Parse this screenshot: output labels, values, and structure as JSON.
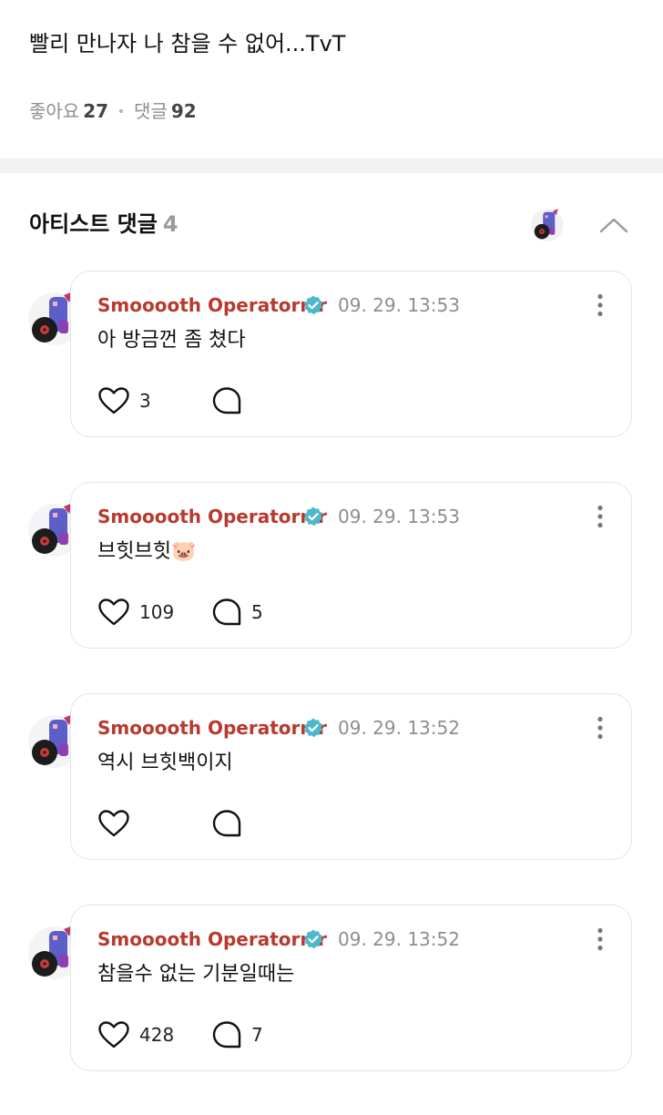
{
  "post": {
    "text": "빨리 만나자 나 참을 수 없어...TvT",
    "likes_label": "좋아요",
    "likes_count": "27",
    "comments_label": "댓글",
    "comments_count": "92"
  },
  "artist_comments": {
    "title": "아티스트 댓글",
    "count": "4",
    "collapse_icon": "chevron-up-icon"
  },
  "comments": [
    {
      "author": "Smooooth Operatorrrr",
      "verified": true,
      "time": "09. 29. 13:53",
      "text": "아 방금껀 좀 쳤다",
      "likes": "3",
      "replies": ""
    },
    {
      "author": "Smooooth Operatorrrr",
      "verified": true,
      "time": "09. 29. 13:53",
      "text": "브힛브힛🐷",
      "likes": "109",
      "replies": "5"
    },
    {
      "author": "Smooooth Operatorrrr",
      "verified": true,
      "time": "09. 29. 13:52",
      "text": "역시 브힛백이지",
      "likes": "",
      "replies": ""
    },
    {
      "author": "Smooooth Operatorrrr",
      "verified": true,
      "time": "09. 29. 13:52",
      "text": "참을수 없는 기분일때는",
      "likes": "428",
      "replies": "7"
    }
  ],
  "colors": {
    "author_name": "#b83a2e",
    "verified_badge": "#4cb8c9",
    "meta_text": "#8e8e8e",
    "card_border": "#e4e4ea"
  },
  "icons": {
    "like": "heart-outline-icon",
    "reply": "speech-bubble-outline-icon",
    "more": "vertical-ellipsis-icon",
    "verified": "verified-check-badge-icon"
  }
}
